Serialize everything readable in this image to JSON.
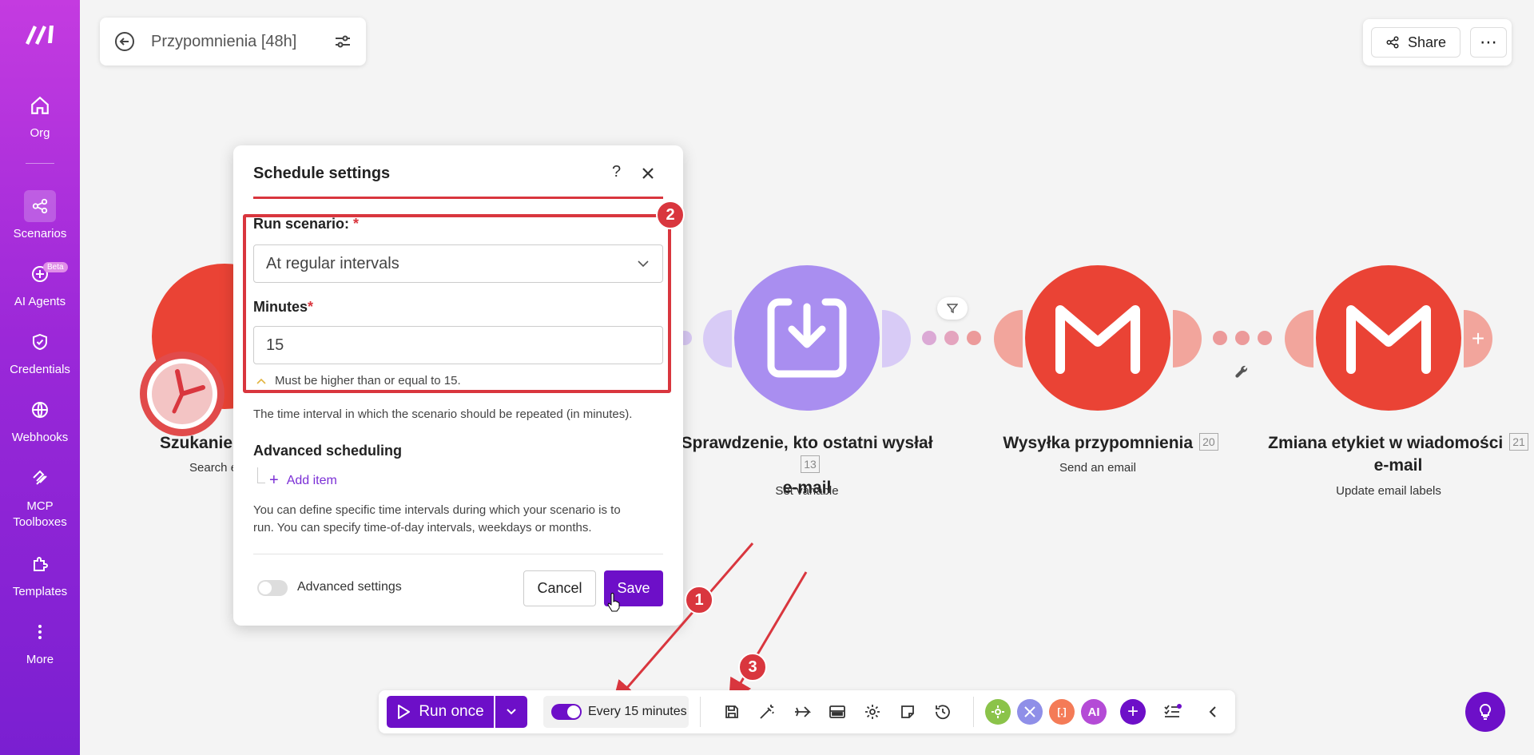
{
  "sidebar": {
    "items": [
      {
        "label": "Org"
      },
      {
        "label": "Scenarios"
      },
      {
        "label": "AI Agents"
      },
      {
        "label": "Credentials"
      },
      {
        "label": "Webhooks"
      },
      {
        "label": "MCP\nToolboxes"
      },
      {
        "label": "Templates"
      },
      {
        "label": "More"
      }
    ],
    "beta_badge": "Beta"
  },
  "header": {
    "scenario_title": "Przypomnienia [48h]",
    "share_label": "Share",
    "more_label": "⋯"
  },
  "modules": [
    {
      "name": "Szukanie",
      "sub": "Search e",
      "id": ""
    },
    {
      "name": "Sprawdzenie, kto ostatni wysłał e-mail",
      "name_line1": "Sprawdzenie, kto ostatni wysłał",
      "name_line2": "e-mail",
      "sub": "Set variable",
      "id": "13"
    },
    {
      "name": "Wysyłka przypomnienia",
      "sub": "Send an email",
      "id": "20"
    },
    {
      "name_line1": "Zmiana etykiet w wiadomości",
      "name_line2": "e-mail",
      "sub": "Update email labels",
      "id": "21"
    }
  ],
  "dialog": {
    "title": "Schedule settings",
    "help": "?",
    "run_scenario_label": "Run scenario:",
    "required_mark": "*",
    "run_scenario_value": "At regular intervals",
    "minutes_label": "Minutes",
    "minutes_value": "15",
    "minutes_hint": "Must be higher than or equal to 15.",
    "minutes_desc": "The time interval in which the scenario should be repeated (in minutes).",
    "advanced_scheduling": "Advanced scheduling",
    "add_item": "Add item",
    "advanced_desc_1": "You can define specific time intervals during which your scenario is to",
    "advanced_desc_2": "run. You can specify time-of-day intervals, weekdays or months.",
    "advanced_settings": "Advanced settings",
    "cancel": "Cancel",
    "save": "Save"
  },
  "badges": [
    "1",
    "2",
    "3"
  ],
  "toolbar": {
    "run_once": "Run once",
    "schedule": "Every 15 minutes",
    "ai_chip": "AI"
  },
  "colors": {
    "accent": "#6d0fc8",
    "gmail_red": "#ea4335",
    "annotation_red": "#d9363e",
    "setvar_purple": "#a98ef0"
  }
}
